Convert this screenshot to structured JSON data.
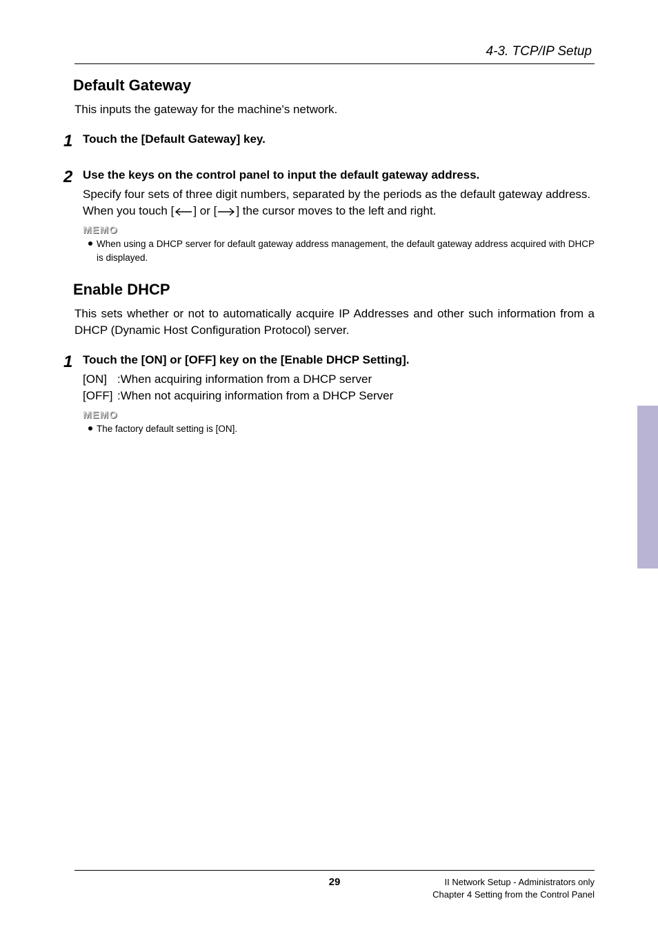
{
  "runningHead": "4-3. TCP/IP Setup",
  "section1": {
    "heading": "Default Gateway",
    "intro": "This inputs the gateway for the machine's network.",
    "steps": [
      {
        "num": "1",
        "title": "Touch the [Default Gateway] key."
      },
      {
        "num": "2",
        "title": "Use the keys on the control panel to input the default gateway address.",
        "para": "Specify four sets of three digit numbers, separated by the periods as the default gateway address.",
        "line_pre": "When you touch [",
        "line_mid": "] or [",
        "line_post": "] the cursor moves to the left and right.",
        "memoLabel": "MEMO",
        "memo": "When using a DHCP server for default gateway address management, the default gateway address acquired with DHCP is displayed."
      }
    ]
  },
  "section2": {
    "heading": "Enable DHCP",
    "intro": "This sets whether or not to automatically acquire IP Addresses and other such information from a DHCP (Dynamic Host Configuration Protocol) server.",
    "steps": [
      {
        "num": "1",
        "title": "Touch the [ON] or [OFF] key on the [Enable DHCP Setting].",
        "opt_on_label": "[ON]",
        "opt_on_text": ":When acquiring information from a DHCP server",
        "opt_off_label": "[OFF]",
        "opt_off_text": ":When not acquiring information from a DHCP Server",
        "memoLabel": "MEMO",
        "memo": "The factory default setting is [ON]."
      }
    ]
  },
  "footer": {
    "pageNum": "29",
    "right1": "II Network Setup - Administrators only",
    "right2": "Chapter 4 Setting from the Control Panel"
  }
}
